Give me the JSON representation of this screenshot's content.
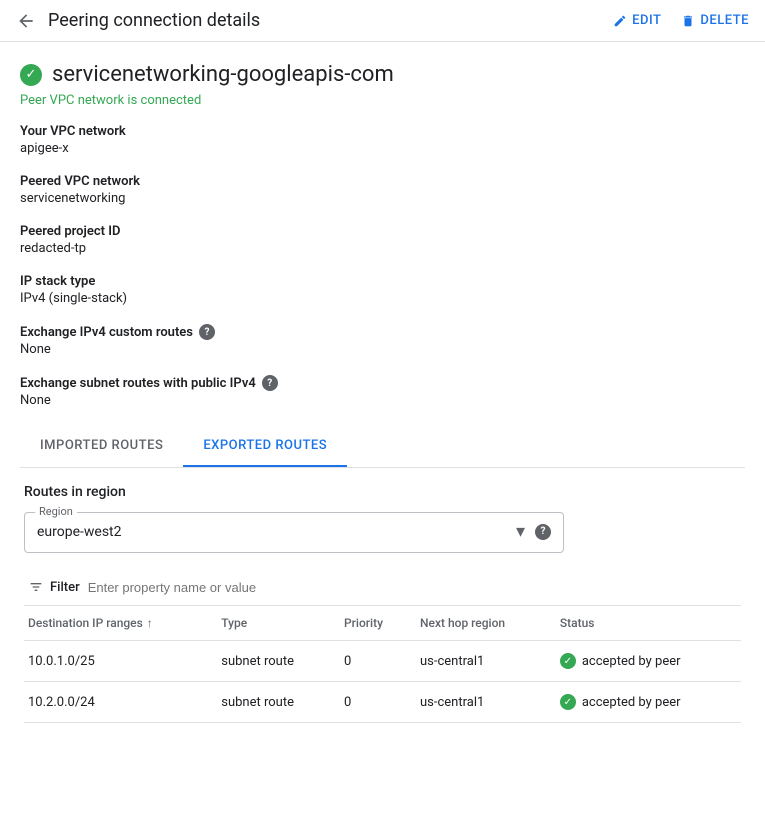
{
  "header": {
    "title": "Peering connection details",
    "back_label": "back",
    "edit_label": "EDIT",
    "delete_label": "DELETE"
  },
  "service": {
    "name": "servicenetworking-googleapis-com",
    "status_text": "Peer VPC network is connected"
  },
  "fields": {
    "your_vpc_label": "Your VPC network",
    "your_vpc_value": "apigee-x",
    "peered_vpc_label": "Peered VPC network",
    "peered_vpc_value": "servicenetworking",
    "peered_project_label": "Peered project ID",
    "peered_project_value": "redacted-tp",
    "ip_stack_label": "IP stack type",
    "ip_stack_value": "IPv4 (single-stack)",
    "exchange_ipv4_label": "Exchange IPv4 custom routes",
    "exchange_ipv4_value": "None",
    "exchange_subnet_label": "Exchange subnet routes with public IPv4",
    "exchange_subnet_value": "None"
  },
  "tabs": [
    {
      "label": "IMPORTED ROUTES",
      "active": false
    },
    {
      "label": "EXPORTED ROUTES",
      "active": true
    }
  ],
  "routes_section": {
    "title": "Routes in region",
    "region_label": "Region",
    "region_value": "europe-west2"
  },
  "filter": {
    "label": "Filter",
    "placeholder": "Enter property name or value"
  },
  "table": {
    "columns": [
      {
        "label": "Destination IP ranges",
        "sortable": true
      },
      {
        "label": "Type",
        "sortable": false
      },
      {
        "label": "Priority",
        "sortable": false
      },
      {
        "label": "Next hop region",
        "sortable": false
      },
      {
        "label": "Status",
        "sortable": false
      }
    ],
    "rows": [
      {
        "destination": "10.0.1.0/25",
        "type": "subnet route",
        "priority": "0",
        "next_hop": "us-central1",
        "status": "accepted by peer"
      },
      {
        "destination": "10.2.0.0/24",
        "type": "subnet route",
        "priority": "0",
        "next_hop": "us-central1",
        "status": "accepted by peer"
      }
    ]
  },
  "icons": {
    "check": "✓",
    "sort_asc": "↑",
    "dropdown": "▼",
    "filter_lines": "≡",
    "edit_pencil": "✏",
    "delete_trash": "🗑",
    "back_arrow": "←",
    "help": "?"
  }
}
